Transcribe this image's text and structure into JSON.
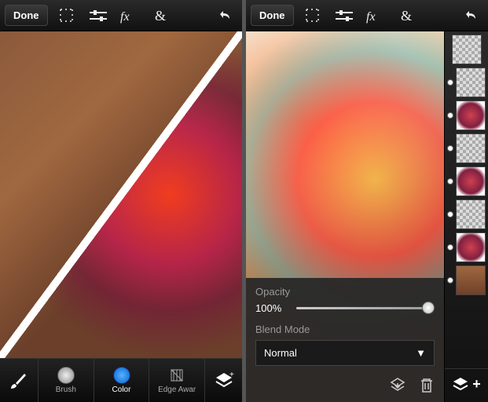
{
  "left": {
    "done": "Done",
    "tools": {
      "brush": "Brush",
      "color": "Color",
      "edge": "Edge Awar"
    }
  },
  "right": {
    "done": "Done",
    "opacity": {
      "label": "Opacity",
      "value": "100%"
    },
    "blend": {
      "label": "Blend Mode",
      "value": "Normal"
    }
  }
}
